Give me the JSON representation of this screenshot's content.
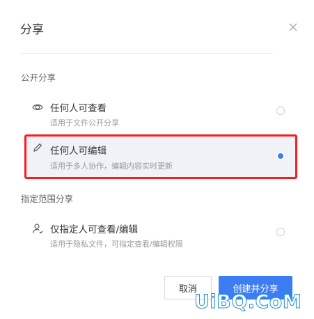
{
  "dialog": {
    "title": "分享",
    "close_icon": "close-icon"
  },
  "public_section": {
    "heading": "公开分享",
    "options": [
      {
        "icon": "eye-icon",
        "label": "任何人可查看",
        "desc": "适用于文件公开分享",
        "selected": false
      },
      {
        "icon": "pencil-icon",
        "label": "任何人可编辑",
        "desc": "适用于多人协作，编辑内容实时更新",
        "selected": true
      }
    ]
  },
  "scoped_section": {
    "heading": "指定范围分享",
    "options": [
      {
        "icon": "user-icon",
        "label": "仅指定人可查看/编辑",
        "desc": "适用于隐私文件，可指定查看/编辑权限",
        "selected": false
      }
    ]
  },
  "buttons": {
    "cancel": "取消",
    "create": "创建并分享"
  },
  "watermark": "UiBQ.CoM",
  "colors": {
    "accent": "#3d7df3",
    "highlight_border": "#ff1a1a"
  }
}
